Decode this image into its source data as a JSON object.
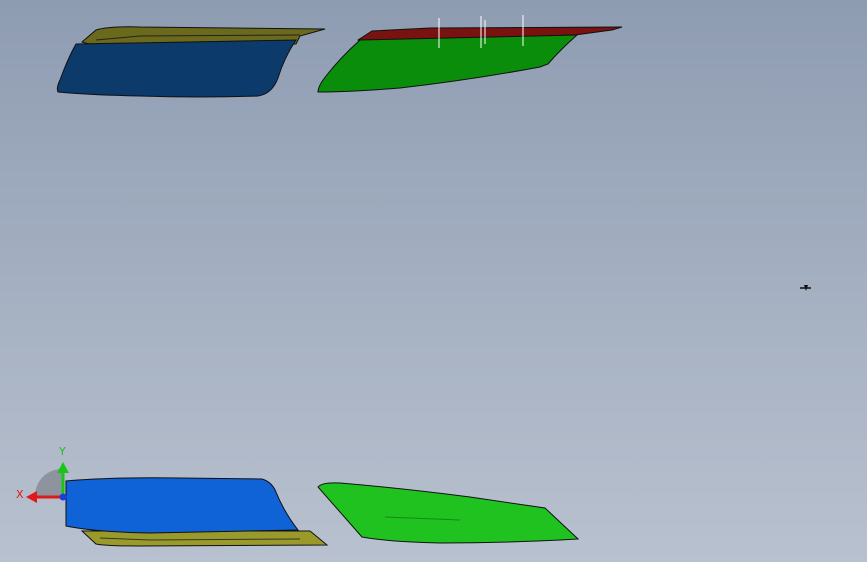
{
  "viewport": {
    "background_top": "#8e9cb2",
    "background_bottom": "#b8c1cf"
  },
  "parts": {
    "upper_blue_panel": {
      "face_color": "#0b3a6b",
      "flange_color": "#6b6a1c"
    },
    "upper_green_panel": {
      "face_color": "#0a8d0a",
      "flange_color": "#7a1210"
    },
    "lower_blue_panel": {
      "face_color": "#0f63d6",
      "flange_color": "#9a9a2a"
    },
    "lower_green_panel": {
      "face_color": "#1fc21f"
    }
  },
  "triad": {
    "x_label": "X",
    "y_label": "Y",
    "x_color": "#e01818",
    "y_color": "#19c419",
    "z_color": "#1d3fd8"
  },
  "cursor_icon": "rotate-cursor-icon"
}
